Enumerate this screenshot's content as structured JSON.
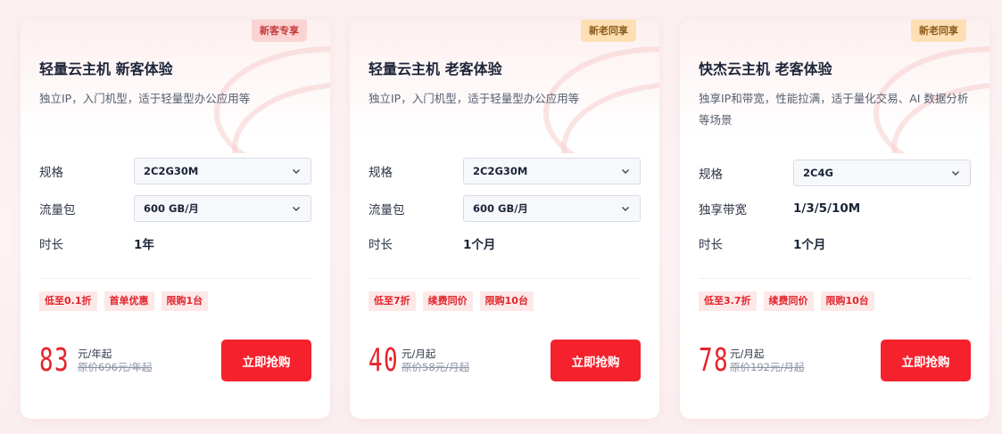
{
  "cards": [
    {
      "badge": "新客专享",
      "badge_type": "new",
      "title": "轻量云主机 新客体验",
      "desc": "独立IP，入门机型，适于轻量型办公应用等",
      "rows": [
        {
          "label": "规格",
          "value": "2C2G30M",
          "kind": "select"
        },
        {
          "label": "流量包",
          "value": "600 GB/月",
          "kind": "select"
        },
        {
          "label": "时长",
          "value": "1年",
          "kind": "text"
        }
      ],
      "tags": [
        "低至0.1折",
        "首单优惠",
        "限购1台"
      ],
      "price": "83",
      "price_unit": "元/年起",
      "price_original": "原价696元/年起",
      "buy_label": "立即抢购"
    },
    {
      "badge": "新老同享",
      "badge_type": "old",
      "title": "轻量云主机 老客体验",
      "desc": "独立IP，入门机型，适于轻量型办公应用等",
      "rows": [
        {
          "label": "规格",
          "value": "2C2G30M",
          "kind": "select"
        },
        {
          "label": "流量包",
          "value": "600 GB/月",
          "kind": "select"
        },
        {
          "label": "时长",
          "value": "1个月",
          "kind": "text"
        }
      ],
      "tags": [
        "低至7折",
        "续费同价",
        "限购10台"
      ],
      "price": "40",
      "price_unit": "元/月起",
      "price_original": "原价58元/月起",
      "buy_label": "立即抢购"
    },
    {
      "badge": "新老同享",
      "badge_type": "old",
      "title": "快杰云主机 老客体验",
      "desc": "独享IP和带宽，性能拉满，适于量化交易、AI 数据分析等场景",
      "rows": [
        {
          "label": "规格",
          "value": "2C4G",
          "kind": "select"
        },
        {
          "label": "独享带宽",
          "value": "1/3/5/10M",
          "kind": "text"
        },
        {
          "label": "时长",
          "value": "1个月",
          "kind": "text"
        }
      ],
      "tags": [
        "低至3.7折",
        "续费同价",
        "限购10台"
      ],
      "price": "78",
      "price_unit": "元/月起",
      "price_original": "原价192元/月起",
      "buy_label": "立即抢购"
    }
  ],
  "icons": {
    "select_caret": "chevron-down-icon"
  },
  "colors": {
    "accent": "#f5222d",
    "price": "#e7232b",
    "tag_bg": "#fde8e8"
  }
}
